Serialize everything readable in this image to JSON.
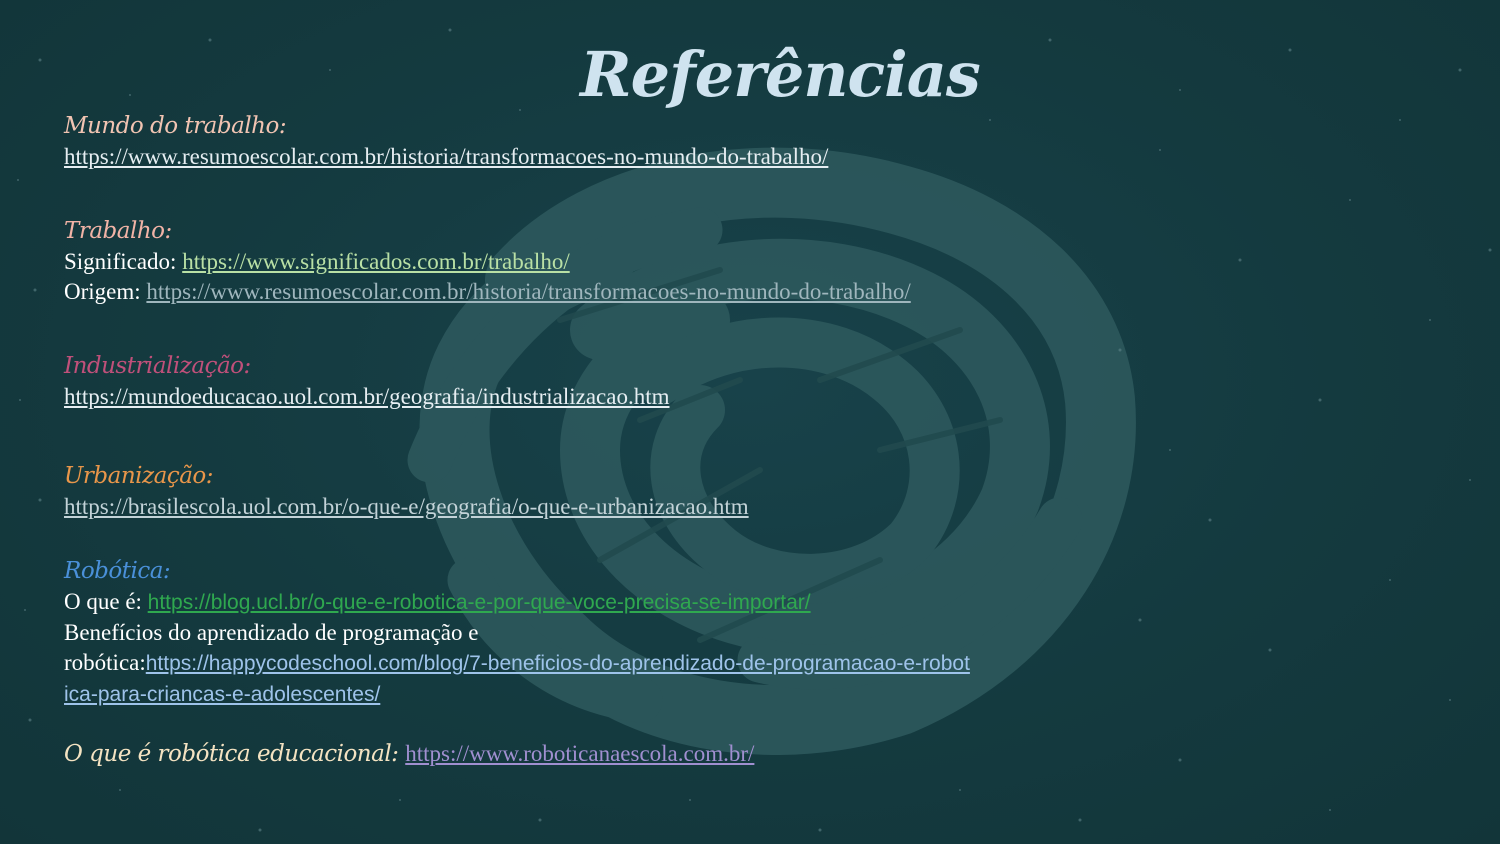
{
  "slide": {
    "title": "Referências"
  },
  "colors": {
    "background": "#143a3f",
    "title": "#cfe3ef",
    "heading_mundo": "#f1c4b2",
    "heading_trabalho": "#f1b3a6",
    "heading_industrializacao": "#c0507a",
    "heading_urbanizacao": "#e8964a",
    "heading_robotica": "#4a90d9",
    "heading_educacional": "#f4e3c2",
    "link_light": "#e6eef2",
    "link_green_light": "#b9e0a5",
    "link_grey": "#9fb6bd",
    "link_green": "#2fa84f",
    "link_blue": "#9ec3ea",
    "link_purple": "#a08fd0"
  },
  "sections": {
    "mundo": {
      "heading": "Mundo do trabalho:",
      "link": "https://www.resumoescolar.com.br/historia/transformacoes-no-mundo-do-trabalho/"
    },
    "trabalho": {
      "heading": "Trabalho:",
      "significado_label": "Significado: ",
      "significado_link": "https://www.significados.com.br/trabalho/",
      "origem_label": "Origem: ",
      "origem_link": "https://www.resumoescolar.com.br/historia/transformacoes-no-mundo-do-trabalho/"
    },
    "industrializacao": {
      "heading": "Industrialização:",
      "link": "https://mundoeducacao.uol.com.br/geografia/industrializacao.htm"
    },
    "urbanizacao": {
      "heading": "Urbanização:",
      "link": "https://brasilescola.uol.com.br/o-que-e/geografia/o-que-e-urbanizacao.htm"
    },
    "robotica": {
      "heading": "Robótica:",
      "oque_label": "O que é: ",
      "oque_link": "https://blog.ucl.br/o-que-e-robotica-e-por-que-voce-precisa-se-importar/",
      "beneficios_label_1": "Benefícios do aprendizado de programação e",
      "beneficios_label_2": "robótica:",
      "beneficios_link_1": "https://happycodeschool.com/blog/7-beneficios-do-aprendizado-de-programacao-e-robot",
      "beneficios_link_2": "ica-para-criancas-e-adolescentes/"
    },
    "educacional": {
      "heading": "O que é robótica educacional: ",
      "link": "https://www.roboticanaescola.com.br/"
    }
  }
}
